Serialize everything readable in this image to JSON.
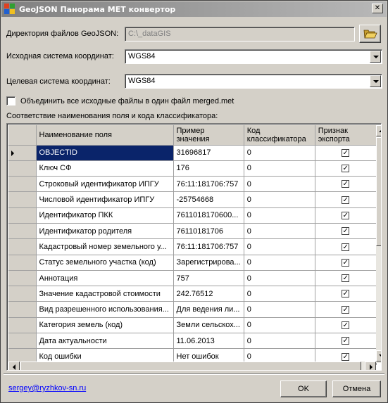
{
  "window": {
    "title": "GeoJSON Панорама MET конвертор",
    "close_glyph": "✕"
  },
  "form": {
    "dir_label": "Директория файлов GeoJSON:",
    "dir_value": "C:\\_dataGIS",
    "browse_icon": "folder-open-icon",
    "src_crs_label": "Исходная система координат:",
    "src_crs_value": "WGS84",
    "dst_crs_label": "Целевая система координат:",
    "dst_crs_value": "WGS84",
    "merge_label": "Объединить все исходные файлы в один файл merged.met",
    "merge_checked": false,
    "mapping_label": "Соответствие наименования поля и кода классификатора:"
  },
  "table": {
    "columns": [
      "Наименование поля",
      "Пример\nзначения",
      "Код\nклассификатора",
      "Признак\nэкспорта"
    ],
    "rows": [
      {
        "name": "OBJECTID",
        "sample": "31696817",
        "code": "0",
        "export": true,
        "selected": true
      },
      {
        "name": "Ключ СФ",
        "sample": "176",
        "code": "0",
        "export": true
      },
      {
        "name": "Строковый идентификатор ИПГУ",
        "sample": "76:11:181706:757",
        "code": "0",
        "export": true
      },
      {
        "name": "Числовой идентификатор ИПГУ",
        "sample": "-25754668",
        "code": "0",
        "export": true
      },
      {
        "name": "Идентификатор ПКК",
        "sample": "7611018170600...",
        "code": "0",
        "export": true
      },
      {
        "name": "Идентификатор родителя",
        "sample": "76110181706",
        "code": "0",
        "export": true
      },
      {
        "name": "Кадастровый номер земельного у...",
        "sample": "76:11:181706:757",
        "code": "0",
        "export": true
      },
      {
        "name": "Статус земельного участка (код)",
        "sample": "Зарегистрирова...",
        "code": "0",
        "export": true
      },
      {
        "name": "Аннотация",
        "sample": "757",
        "code": "0",
        "export": true
      },
      {
        "name": "Значение кадастровой стоимости",
        "sample": "242.76512",
        "code": "0",
        "export": true
      },
      {
        "name": "Вид разрешенного использования...",
        "sample": "Для ведения ли...",
        "code": "0",
        "export": true
      },
      {
        "name": "Категория земель (код)",
        "sample": "Земли сельскох...",
        "code": "0",
        "export": true
      },
      {
        "name": "Дата актуальности",
        "sample": "11.06.2013",
        "code": "0",
        "export": true
      },
      {
        "name": "Код ошибки",
        "sample": "Нет ошибок",
        "code": "0",
        "export": true
      }
    ],
    "check_glyph": "✓"
  },
  "footer": {
    "email": "sergey@ryzhkov-sn.ru",
    "ok_label": "OK",
    "cancel_label": "Отмена"
  }
}
